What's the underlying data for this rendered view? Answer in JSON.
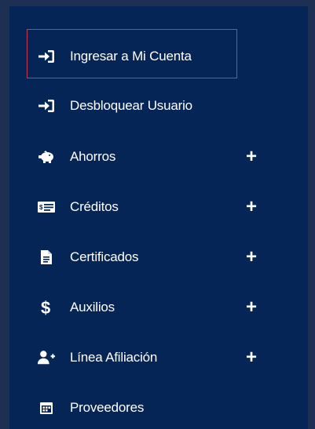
{
  "menu": {
    "items": [
      {
        "label": "Ingresar a Mi Cuenta",
        "icon": "sign-in-icon",
        "expandable": false,
        "selected": true
      },
      {
        "label": "Desbloquear Usuario",
        "icon": "sign-in-icon",
        "expandable": false
      },
      {
        "label": "Ahorros",
        "icon": "piggy-bank-icon",
        "expandable": true,
        "expand_symbol": "+"
      },
      {
        "label": "Créditos",
        "icon": "money-bill-icon",
        "expandable": true,
        "expand_symbol": "+"
      },
      {
        "label": "Certificados",
        "icon": "document-icon",
        "expandable": true,
        "expand_symbol": "+"
      },
      {
        "label": "Auxilios",
        "icon": "dollar-icon",
        "expandable": true,
        "expand_symbol": "+"
      },
      {
        "label": "Línea Afiliación",
        "icon": "user-plus-icon",
        "expandable": true,
        "expand_symbol": "+"
      },
      {
        "label": "Proveedores",
        "icon": "calendar-icon",
        "expandable": false
      }
    ]
  },
  "colors": {
    "background": "#1d2f52",
    "menu_background": "#052556",
    "selection_border": "#c53a55",
    "text": "#ffffff"
  }
}
